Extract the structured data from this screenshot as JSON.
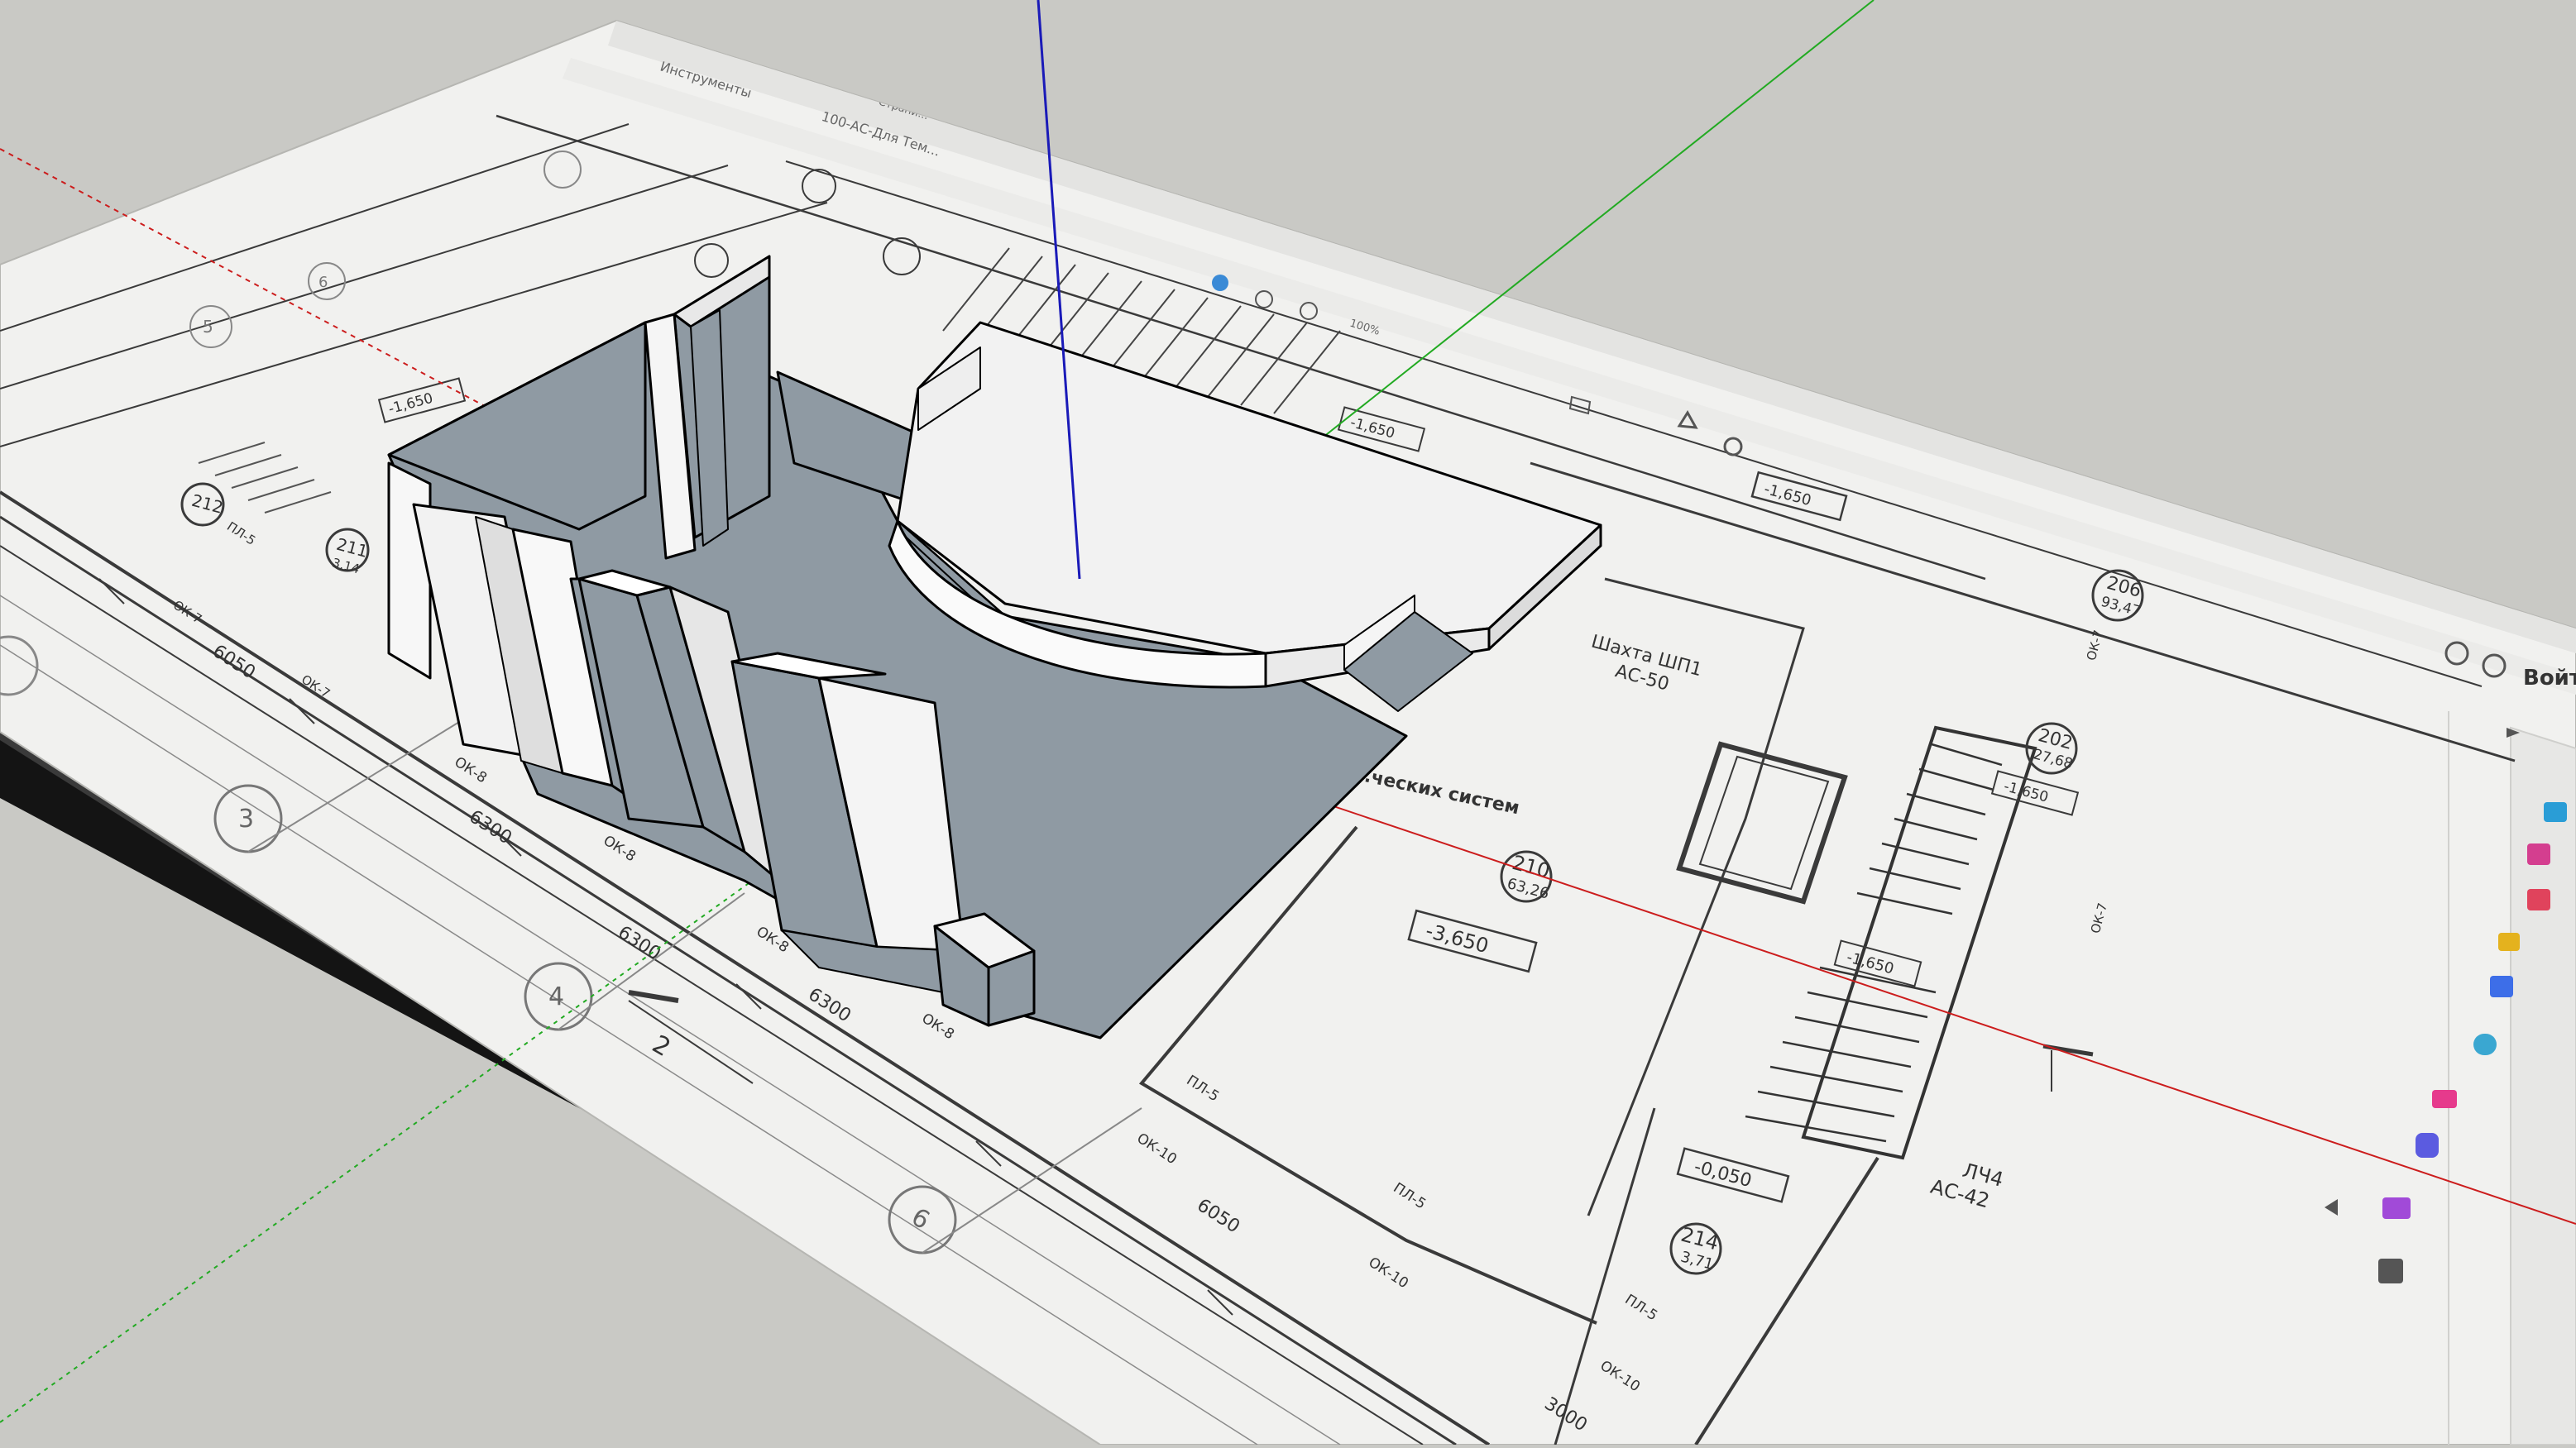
{
  "app": {
    "name": "SketchUp viewport",
    "background": "#c9c9c5",
    "paper_color": "#f1f1ef",
    "model_shadow_color": "#8f9aa3"
  },
  "doc_ui": {
    "tab_pages": "Страни...",
    "tab_tools": "Инструменты",
    "tab_file": "100-АС-Для Тем...",
    "zoom": "100%",
    "signin": "Войт"
  },
  "axes": {
    "red": "#cc1d1d",
    "green": "#22aa22",
    "blue": "#1a1ab8"
  },
  "drawing": {
    "rooms": [
      {
        "num": "206",
        "area": "93,47"
      },
      {
        "num": "202",
        "area": "27,68"
      },
      {
        "num": "210",
        "area": "63,26"
      },
      {
        "num": "214",
        "area": "3,71"
      },
      {
        "num": "212",
        "area": ""
      },
      {
        "num": "211",
        "area": "3,14"
      }
    ],
    "elevations": [
      "-1,650",
      "-1,650",
      "-3,650",
      "-1,650",
      "-0,050",
      "-1,650",
      "-1,650"
    ],
    "shaft_label": "Шахта ШП1",
    "shaft_code": "АС-50",
    "stair_label": "ЛЧ4",
    "stair_code": "АС-42",
    "systems_label": "...ческих систем",
    "dims": [
      "6300",
      "6300",
      "6050",
      "6300",
      "3000",
      "6050"
    ],
    "window_marks": [
      "ОК-8",
      "ОК-8",
      "ОК-8",
      "ОК-8",
      "ОК-10",
      "ОК-10",
      "ОК-10",
      "ОК-7",
      "ОК-7",
      "ОК-7",
      "ОК-7"
    ],
    "beam_marks": [
      "ПЛ-5",
      "ПЛ-5",
      "ПЛ-5",
      "ПЛ-5"
    ],
    "axis_bubbles": [
      "3",
      "4",
      "6",
      "5",
      "6"
    ],
    "section_mark": "2"
  },
  "toolbar_icons": [
    {
      "name": "text-field-icon",
      "color": "#2a9dd6"
    },
    {
      "name": "document-icon",
      "color": "#d43e8f"
    },
    {
      "name": "pdf-icon",
      "color": "#e0435c"
    },
    {
      "name": "comment-icon",
      "color": "#e4b21e"
    },
    {
      "name": "edit-icon",
      "color": "#3d6ee8"
    },
    {
      "name": "compress-icon",
      "color": "#3aa7d1"
    },
    {
      "name": "sign-icon",
      "color": "#e63a8c"
    },
    {
      "name": "protect-icon",
      "color": "#5b5be0"
    },
    {
      "name": "fill-sign-icon",
      "color": "#a14ad8"
    },
    {
      "name": "tools-icon",
      "color": "#555555"
    }
  ]
}
